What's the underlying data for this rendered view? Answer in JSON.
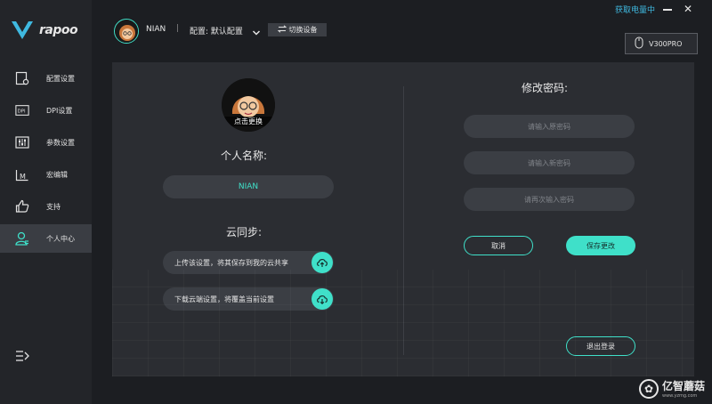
{
  "brand": {
    "name": "rapoo",
    "accent": "#3fe0c9"
  },
  "sidebar": {
    "items": [
      {
        "label": "配置设置",
        "icon": "config-icon"
      },
      {
        "label": "DPI设置",
        "icon": "dpi-icon"
      },
      {
        "label": "参数设置",
        "icon": "sliders-icon"
      },
      {
        "label": "宏编辑",
        "icon": "macro-icon"
      },
      {
        "label": "支持",
        "icon": "thumbs-up-icon"
      },
      {
        "label": "个人中心",
        "icon": "user-icon",
        "active": true
      }
    ]
  },
  "header": {
    "user_name": "NIAN",
    "separator": "|",
    "config_label": "配置: 默认配置",
    "switch_label": "切换设备",
    "cloud_link": "获取电量中",
    "device": "V300PRO"
  },
  "profile": {
    "avatar_caption": "点击更换",
    "name_heading": "个人名称:",
    "name_value": "NIAN",
    "sync_heading": "云同步:",
    "sync_upload": "上传该设置，将其保存到我的云共享",
    "sync_download": "下载云端设置，将覆盖当前设置"
  },
  "password": {
    "heading": "修改密码:",
    "old_placeholder": "请输入原密码",
    "new_placeholder": "请输入新密码",
    "confirm_placeholder": "请再次输入密码",
    "cancel_label": "取消",
    "save_label": "保存更改",
    "logout_label": "退出登录"
  },
  "watermark": {
    "text": "亿智蘑菇",
    "sub": "www.yzmg.com"
  }
}
